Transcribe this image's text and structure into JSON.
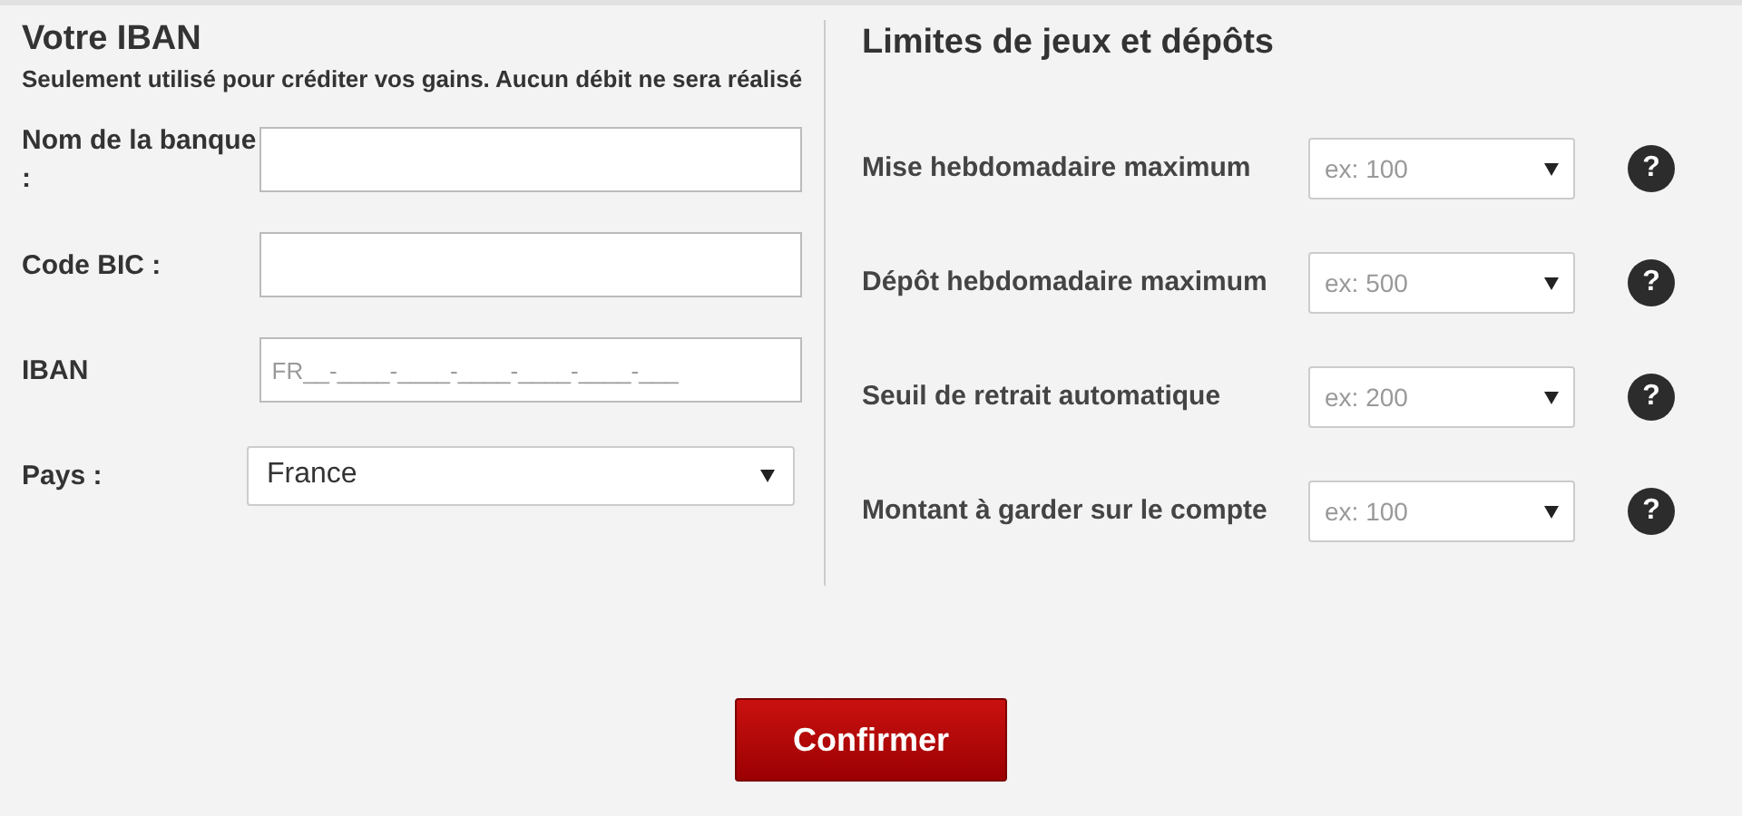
{
  "iban_section": {
    "title": "Votre IBAN",
    "note": "Seulement utilisé pour créditer vos gains. Aucun débit ne sera réalisé",
    "fields": [
      {
        "kind": "text",
        "label": "Nom de la banque :"
      },
      {
        "kind": "text",
        "label": "Code BIC :"
      },
      {
        "kind": "text",
        "label": "IBAN",
        "placeholder": "FR__-____-____-____-____-____-___"
      },
      {
        "kind": "select",
        "label": "Pays :",
        "value": "France"
      }
    ]
  },
  "limits_section": {
    "title": "Limites de jeux et dépôts",
    "rows": [
      {
        "label": "Mise hebdomadaire maximum",
        "placeholder": "ex: 100",
        "help": "?"
      },
      {
        "label": "Dépôt hebdomadaire maximum",
        "placeholder": "ex: 500",
        "help": "?"
      },
      {
        "label": "Seuil de retrait automatique",
        "placeholder": "ex: 200",
        "help": "?"
      },
      {
        "label": "Montant à garder sur le compte",
        "placeholder": "ex: 100",
        "help": "?"
      }
    ]
  },
  "confirm_button": "Confirmer"
}
